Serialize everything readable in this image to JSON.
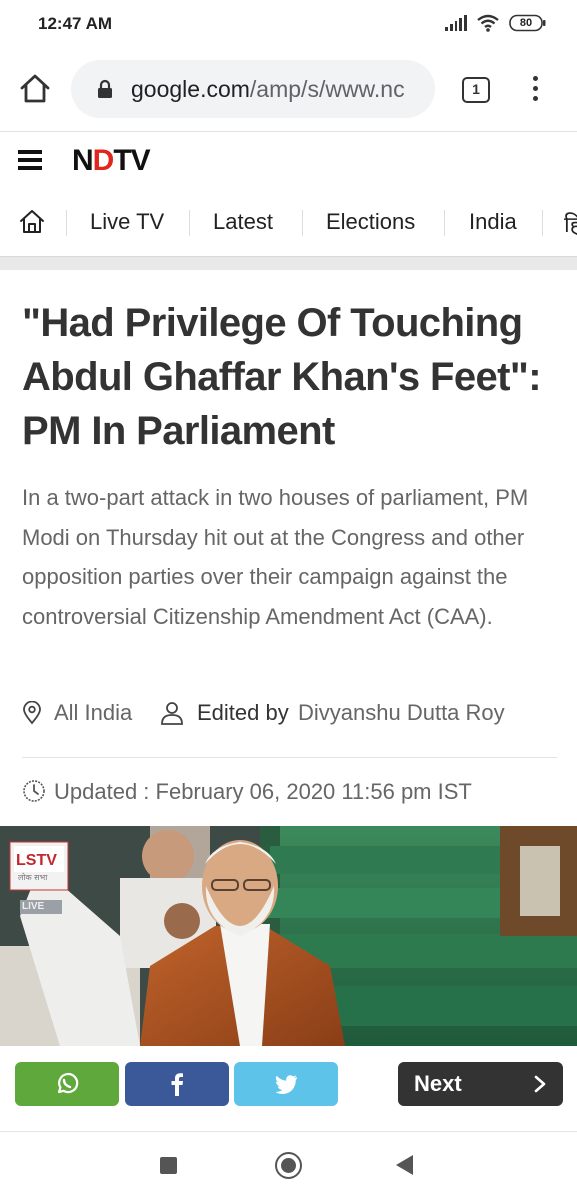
{
  "status_bar": {
    "time": "12:47 AM",
    "battery": "80"
  },
  "browser": {
    "url_host": "google.com",
    "url_path": "/amp/s/www.nc",
    "tab_count": "1"
  },
  "site": {
    "logo_pre": "N",
    "logo_dot": "D",
    "logo_post": "TV"
  },
  "nav": {
    "items": [
      "Live TV",
      "Latest",
      "Elections",
      "India",
      "हि"
    ]
  },
  "article": {
    "headline": "\"Had Privilege Of Touching Abdul Ghaffar Khan's Feet\": PM In Parliament",
    "summary": "In a two-part attack in two houses of parliament, PM Modi on Thursday hit out at the Congress and other opposition parties over their campaign against the controversial Citizenship Amendment Act (CAA).",
    "location": "All India",
    "edited_prefix": "Edited by",
    "editor": "Divyanshu Dutta Roy",
    "updated": "Updated : February 06, 2020 11:56 pm IST"
  },
  "photo": {
    "channel_logo": "LSTV",
    "channel_sub": "लोक सभा",
    "live_tag": "LIVE"
  },
  "share": {
    "next_label": "Next"
  },
  "colors": {
    "whatsapp": "#5fa83b",
    "facebook": "#3b5998",
    "twitter": "#5ec3e8",
    "next_bg": "#333333",
    "ndtv_red": "#e1261c"
  },
  "icons": [
    "home-icon",
    "lock-icon",
    "tabs-icon",
    "more-vert-icon",
    "hamburger-icon",
    "location-pin-icon",
    "person-icon",
    "clock-icon",
    "whatsapp-icon",
    "facebook-icon",
    "twitter-icon",
    "chevron-right-icon"
  ]
}
